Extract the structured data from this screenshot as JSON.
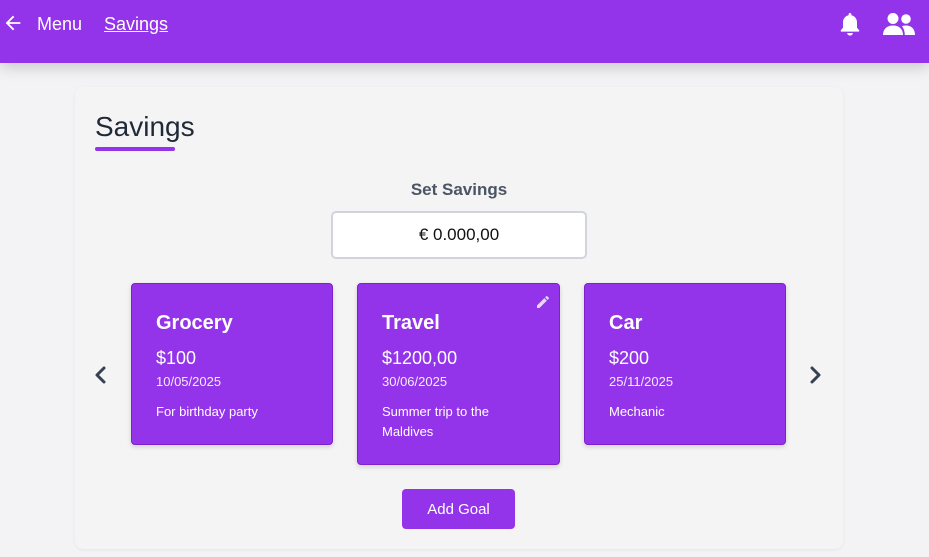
{
  "header": {
    "menu_label": "Menu",
    "breadcrumb_label": "Savings",
    "brand_color": "#9333ea",
    "icons": [
      "back-arrow-icon",
      "bell-icon",
      "users-icon"
    ]
  },
  "main": {
    "title": "Savings",
    "set_savings_label": "Set Savings",
    "amount_value": "€ 0.000,00"
  },
  "goals": [
    {
      "title": "Grocery",
      "amount": "$100",
      "date": "10/05/2025",
      "note": "For birthday party"
    },
    {
      "title": "Travel",
      "amount": "$1200,00",
      "date": "30/06/2025",
      "note": "Summer trip to the Maldives"
    },
    {
      "title": "Car",
      "amount": "$200",
      "date": "25/11/2025",
      "note": "Mechanic"
    }
  ],
  "carousel": {
    "prev_icon": "chevron-left-icon",
    "next_icon": "chevron-right-icon"
  },
  "add_goal_label": "Add Goal"
}
